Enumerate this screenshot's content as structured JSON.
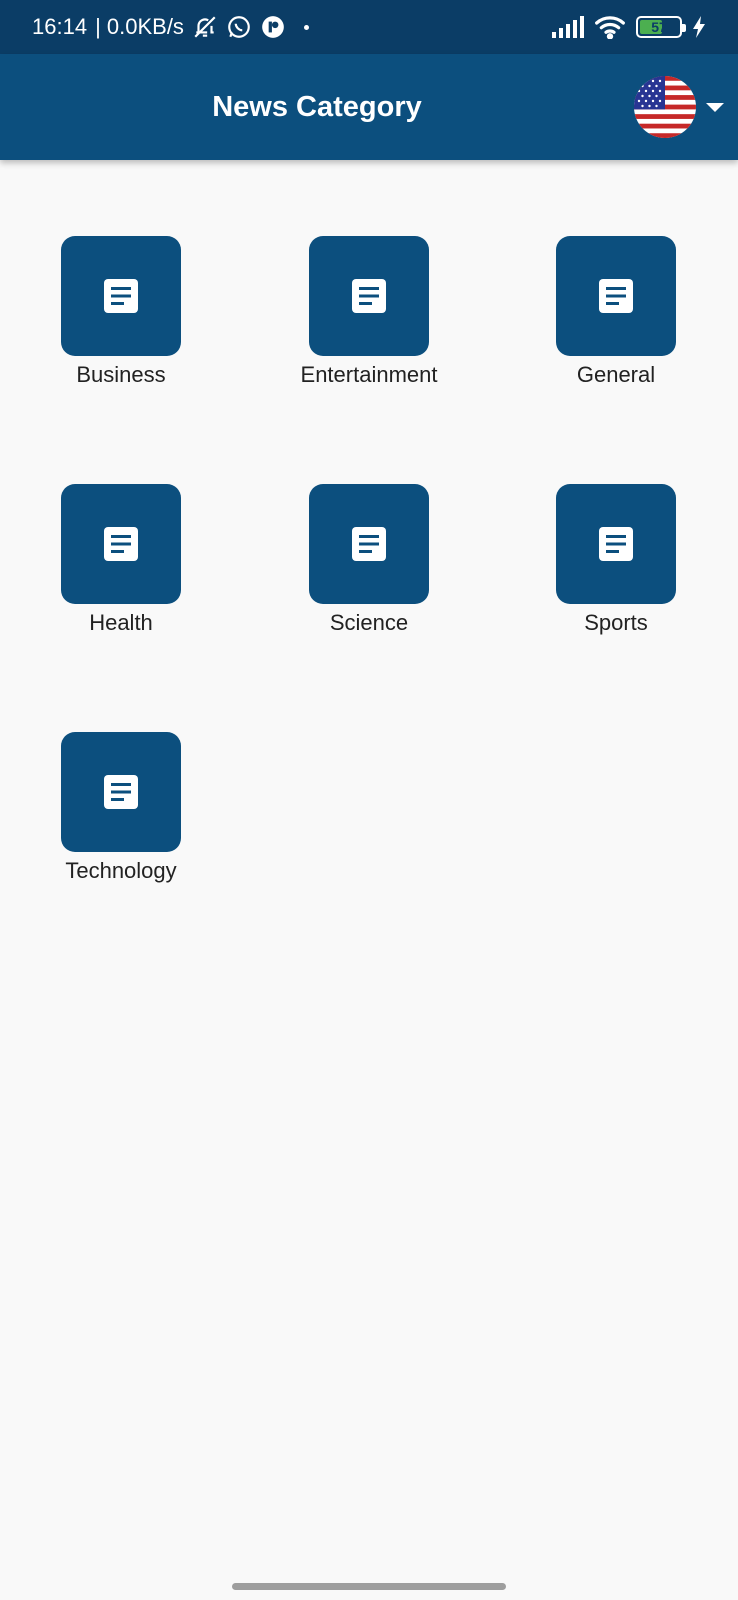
{
  "status_bar": {
    "time": "16:14",
    "net_speed": "| 0.0KB/s",
    "battery_level": "57",
    "battery_fraction": 0.57,
    "icons": [
      "bell-off-icon",
      "whatsapp-icon",
      "app-badge-icon",
      "dot-icon",
      "signal-icon",
      "wifi-icon",
      "battery-icon",
      "charging-icon"
    ]
  },
  "app_bar": {
    "title": "News Category",
    "country_flag": "us-flag-icon",
    "dropdown_icon": "caret-down-icon"
  },
  "categories": [
    {
      "label": "Business",
      "icon": "article-icon"
    },
    {
      "label": "Entertainment",
      "icon": "article-icon"
    },
    {
      "label": "General",
      "icon": "article-icon"
    },
    {
      "label": "Health",
      "icon": "article-icon"
    },
    {
      "label": "Science",
      "icon": "article-icon"
    },
    {
      "label": "Sports",
      "icon": "article-icon"
    },
    {
      "label": "Technology",
      "icon": "article-icon"
    }
  ],
  "colors": {
    "status_bar_bg": "#0b3d66",
    "primary": "#0c4f7e",
    "background": "#f9f9f9",
    "text": "#222222"
  }
}
